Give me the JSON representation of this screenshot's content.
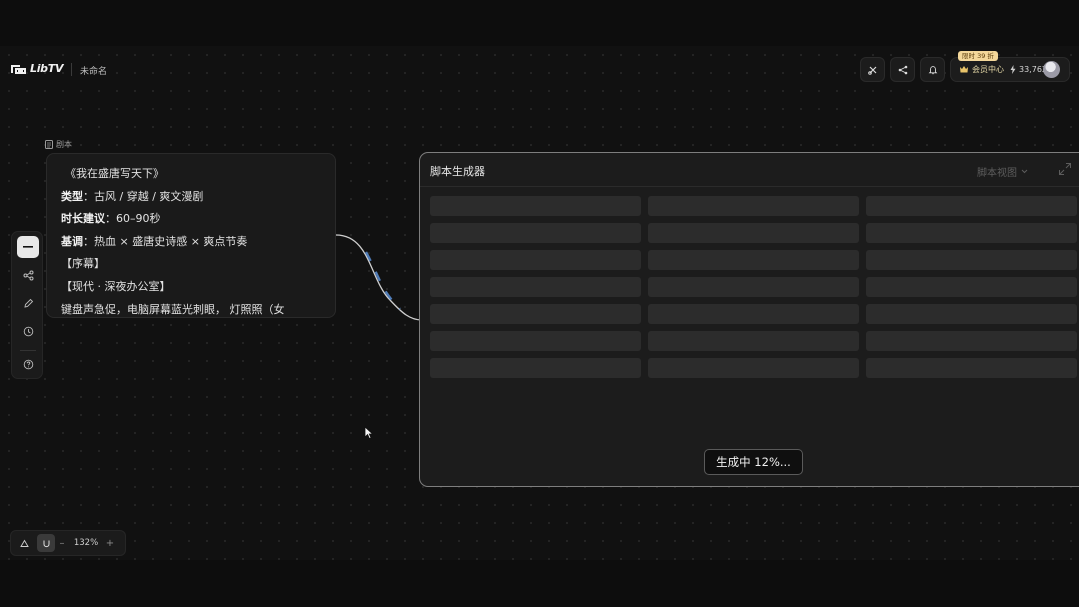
{
  "header": {
    "logo_text": "LibTV",
    "project_name": "未命名",
    "member_label": "会员中心",
    "credits": "33,762",
    "promo_badge": "限时 39 折"
  },
  "script_node": {
    "label": "剧本",
    "lines": [
      {
        "key": "",
        "text": "《我在盛唐写天下》"
      },
      {
        "key": "类型",
        "text": "：古风 / 穿越 / 爽文漫剧"
      },
      {
        "key": "时长建议",
        "text": "：60–90秒"
      },
      {
        "key": "基调",
        "text": "：热血 × 盛唐史诗感 × 爽点节奏"
      },
      {
        "key": "",
        "text": "【序幕】"
      },
      {
        "key": "",
        "text": "【现代 · 深夜办公室】"
      },
      {
        "key": "",
        "text": "键盘声急促，电脑屏幕蓝光刺眼，                    灯照照（女"
      }
    ]
  },
  "generator": {
    "title": "脚本生成器",
    "view_label": "脚本视图",
    "progress_text": "生成中 12%...",
    "progress": 0.12
  },
  "zoom": {
    "level": "132%",
    "minus": "–",
    "plus": "+"
  },
  "icons": {
    "header_buttons": [
      "cut-icon",
      "share-icon",
      "bell-icon"
    ],
    "toolbar": [
      "minus-icon",
      "workflow-icon",
      "edit-icon",
      "history-icon",
      "help-icon"
    ]
  },
  "colors": {
    "accent_link": "#5b8fd6",
    "member_gold": "#e6d9a8",
    "badge_bg": "#f3d79a"
  }
}
